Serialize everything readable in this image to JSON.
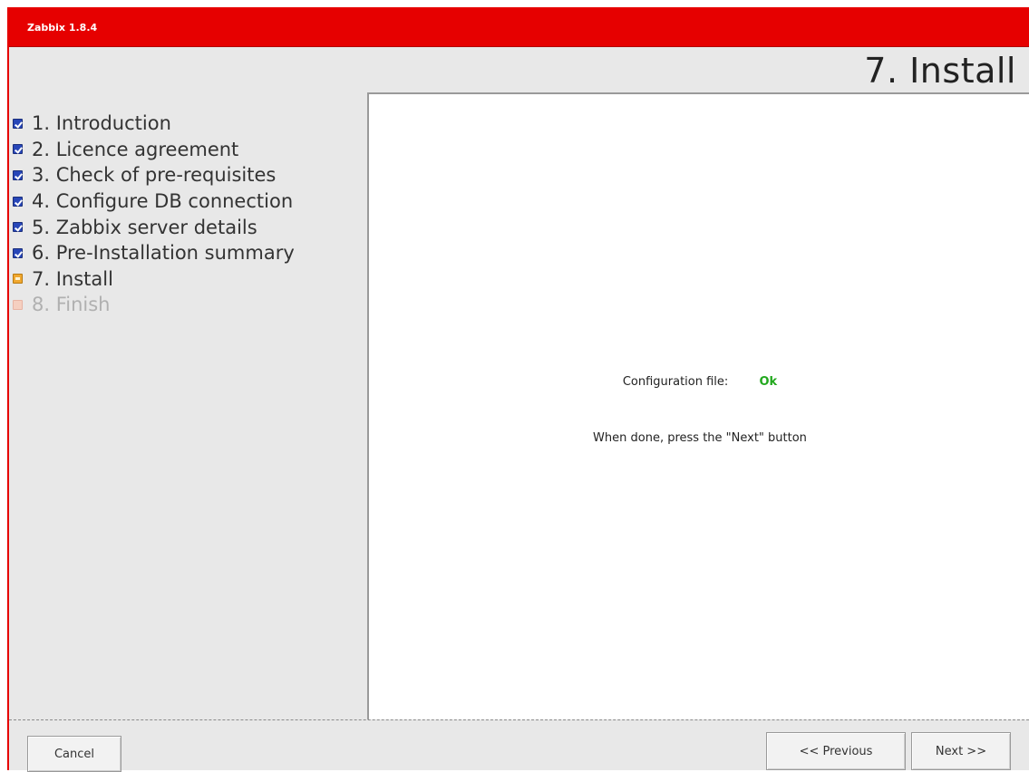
{
  "app": {
    "title": "Zabbix 1.8.4"
  },
  "step_heading": "7. Install",
  "steps": [
    {
      "label": "1. Introduction",
      "state": "done"
    },
    {
      "label": "2. Licence agreement",
      "state": "done"
    },
    {
      "label": "3. Check of pre-requisites",
      "state": "done"
    },
    {
      "label": "4. Configure DB connection",
      "state": "done"
    },
    {
      "label": "5. Zabbix server details",
      "state": "done"
    },
    {
      "label": "6. Pre-Installation summary",
      "state": "done"
    },
    {
      "label": "7. Install",
      "state": "current"
    },
    {
      "label": "8. Finish",
      "state": "todo"
    }
  ],
  "content": {
    "config_label": "Configuration file:",
    "config_status": "Ok",
    "hint": "When done, press the \"Next\" button"
  },
  "buttons": {
    "cancel": "Cancel",
    "previous": "<< Previous",
    "next": "Next >>"
  },
  "colors": {
    "titlebar": "#e60000",
    "ok": "#22a81e",
    "step_done": "#2746b8",
    "step_current": "#f0a830",
    "step_todo": "#f5cfc0"
  },
  "icons": {
    "done": "checked-box-icon",
    "current": "arrow-box-icon",
    "todo": "pending-box-icon"
  }
}
